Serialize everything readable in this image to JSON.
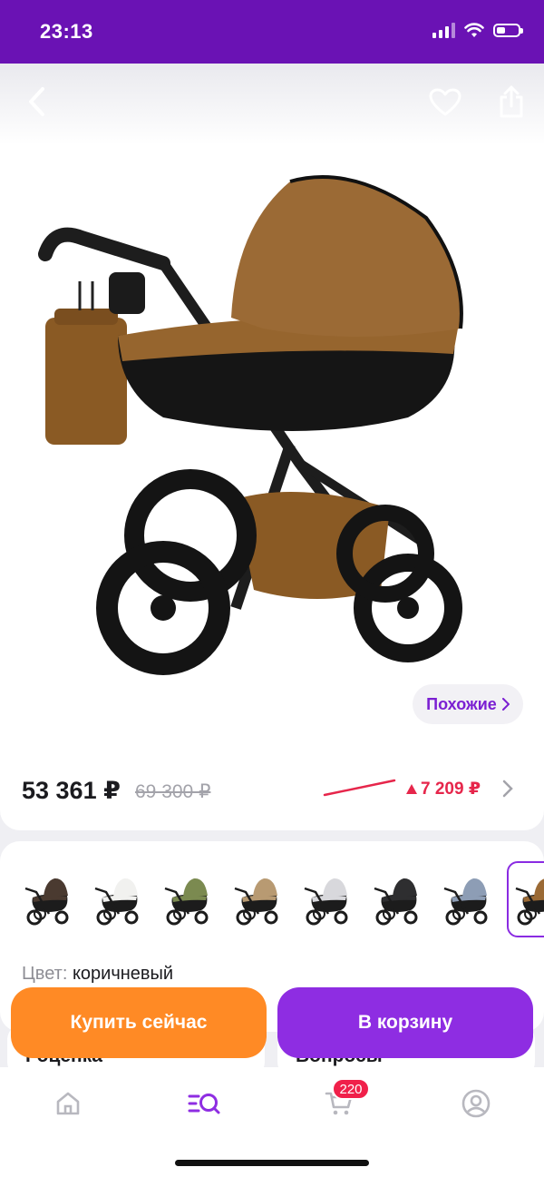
{
  "status_bar": {
    "time": "23:13"
  },
  "header": {
    "back_icon": "chevron-left-icon",
    "favorite_icon": "heart-icon",
    "share_icon": "share-icon"
  },
  "product": {
    "image": "stroller-photo",
    "similar_label": "Похожие",
    "price": "53 361 ₽",
    "old_price": "69 300 ₽",
    "price_drop": "7 209 ₽",
    "colors": {
      "accent": "#8e2de2",
      "buy": "#ff8a25",
      "drop": "#e6264b",
      "status_bar": "#6a12b4"
    }
  },
  "variants": {
    "items": [
      {
        "name": "brown-dark",
        "color": "#4a3a30"
      },
      {
        "name": "white",
        "color": "#f1f1ef"
      },
      {
        "name": "olive",
        "color": "#7b8a50"
      },
      {
        "name": "beige",
        "color": "#b89a72"
      },
      {
        "name": "silver",
        "color": "#d8d8dc"
      },
      {
        "name": "black",
        "color": "#2e2e30"
      },
      {
        "name": "blue-grey",
        "color": "#8d9db5"
      },
      {
        "name": "brown",
        "color": "#9b6a35"
      }
    ],
    "selected_index": 7,
    "color_label": "Цвет:",
    "color_value": "коричневый"
  },
  "peek": {
    "left_title": "Γоценка",
    "right_title": "Вопросы"
  },
  "actions": {
    "buy_now": "Купить сейчас",
    "to_cart": "В корзину"
  },
  "tabbar": {
    "cart_badge": "220"
  }
}
